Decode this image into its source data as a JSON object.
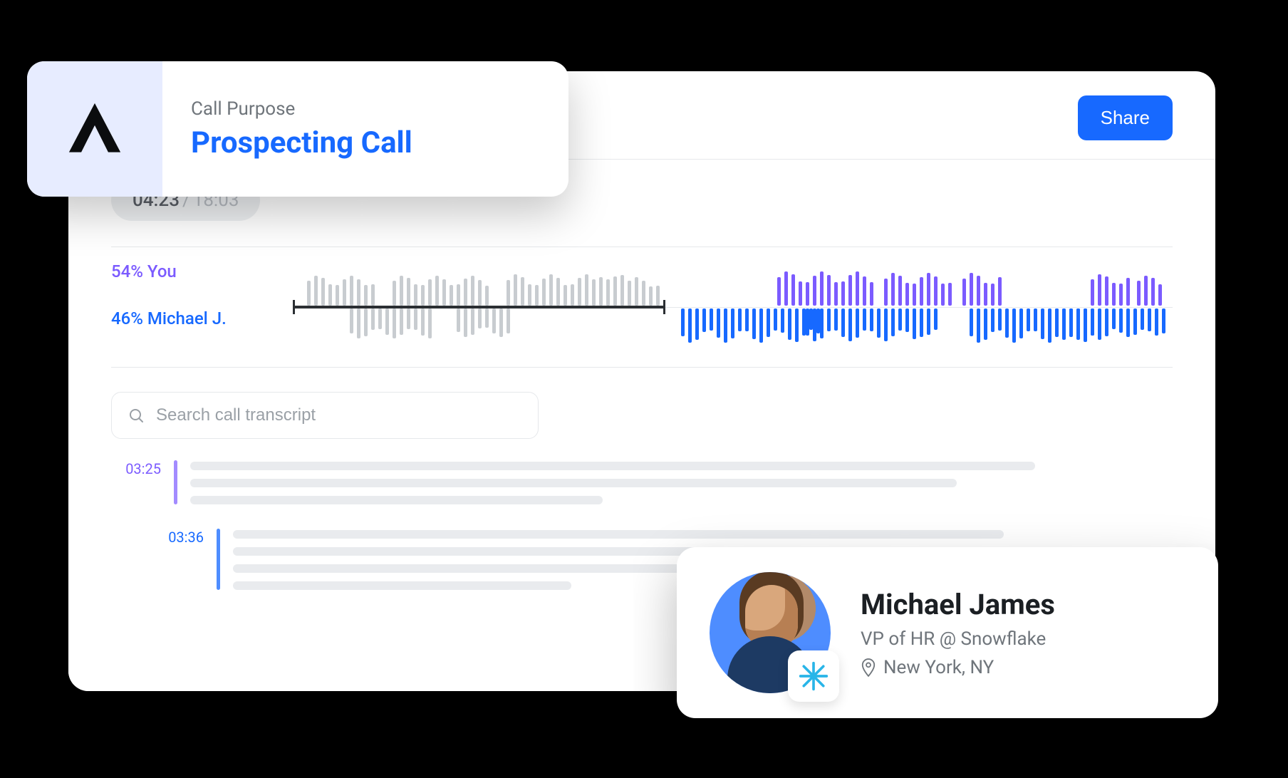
{
  "header": {
    "share_label": "Share"
  },
  "time": {
    "current": "04:23",
    "total": "18:03"
  },
  "speakers": {
    "you": {
      "label": "54% You",
      "percent": 54
    },
    "other": {
      "label": "46% Michael J.",
      "percent": 46
    }
  },
  "search": {
    "placeholder": "Search call transcript"
  },
  "transcript": {
    "rows": [
      {
        "time": "03:25",
        "speaker": "you"
      },
      {
        "time": "03:36",
        "speaker": "other"
      }
    ]
  },
  "purpose": {
    "label": "Call Purpose",
    "value": "Prospecting Call"
  },
  "contact": {
    "name": "Michael James",
    "title": "VP of HR @ Snowflake",
    "location": "New York, NY",
    "company_icon": "snowflake-icon"
  }
}
